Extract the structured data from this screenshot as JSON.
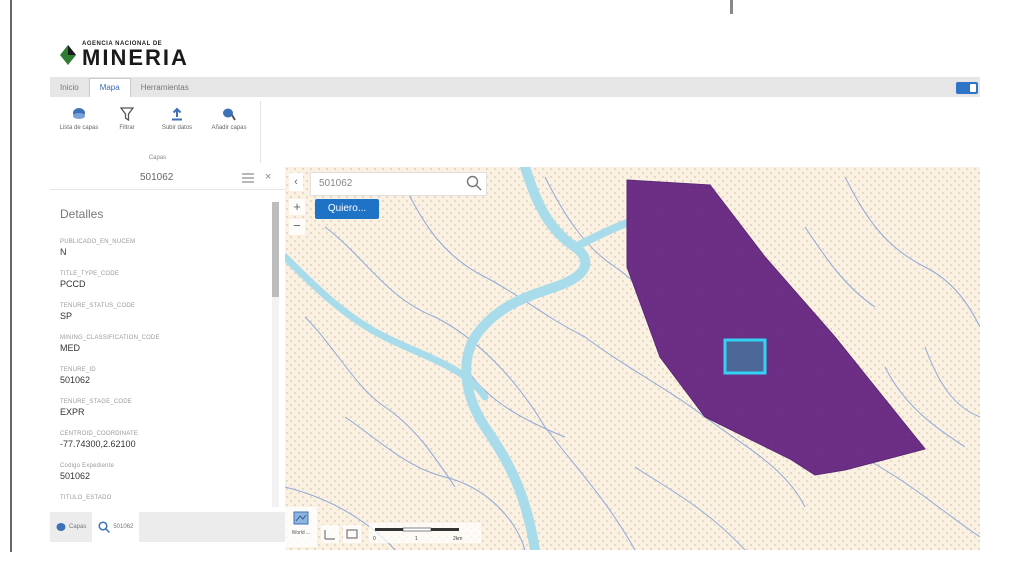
{
  "brand": {
    "small": "AGENCIA NACIONAL DE",
    "big": "MINERIA"
  },
  "tabs": [
    "Inicio",
    "Mapa",
    "Herramientas"
  ],
  "ribbon": {
    "tools": [
      {
        "label": "Lista de capas",
        "icon": "layers-icon"
      },
      {
        "label": "Filtrar",
        "icon": "filter-icon"
      },
      {
        "label": "Subir datos",
        "icon": "upload-icon"
      },
      {
        "label": "Añadir capas",
        "icon": "add-layers-icon"
      }
    ],
    "group_label": "Capas"
  },
  "sidebar": {
    "title": "501062",
    "details_label": "Detalles",
    "attributes": [
      {
        "key": "PUBLICADO_EN_NUCEM",
        "value": "N"
      },
      {
        "key": "TITLE_TYPE_CODE",
        "value": "PCCD"
      },
      {
        "key": "TENURE_STATUS_CODE",
        "value": "SP"
      },
      {
        "key": "MINING_CLASSIFICATION_CODE",
        "value": "MED"
      },
      {
        "key": "TENURE_ID",
        "value": "501062"
      },
      {
        "key": "TENURE_STAGE_CODE",
        "value": "EXPR"
      },
      {
        "key": "CENTROID_COORDINATE",
        "value": "-77.74300,2.62100"
      },
      {
        "key": "Codigo Expediente",
        "value": "501062"
      },
      {
        "key": "TITULO_ESTADO",
        "value": ""
      }
    ],
    "bottom_tabs": [
      "Capas",
      "501062"
    ]
  },
  "map": {
    "search_value": "501062",
    "quiero_label": "Quiero...",
    "basemap_label": "World ...",
    "scale_labels": [
      "0",
      "1",
      "2km"
    ]
  },
  "colors": {
    "accent": "#1f73c7",
    "polygon": "#6d2f86",
    "selection": "#33d2f2",
    "river": "#a8dcea"
  }
}
